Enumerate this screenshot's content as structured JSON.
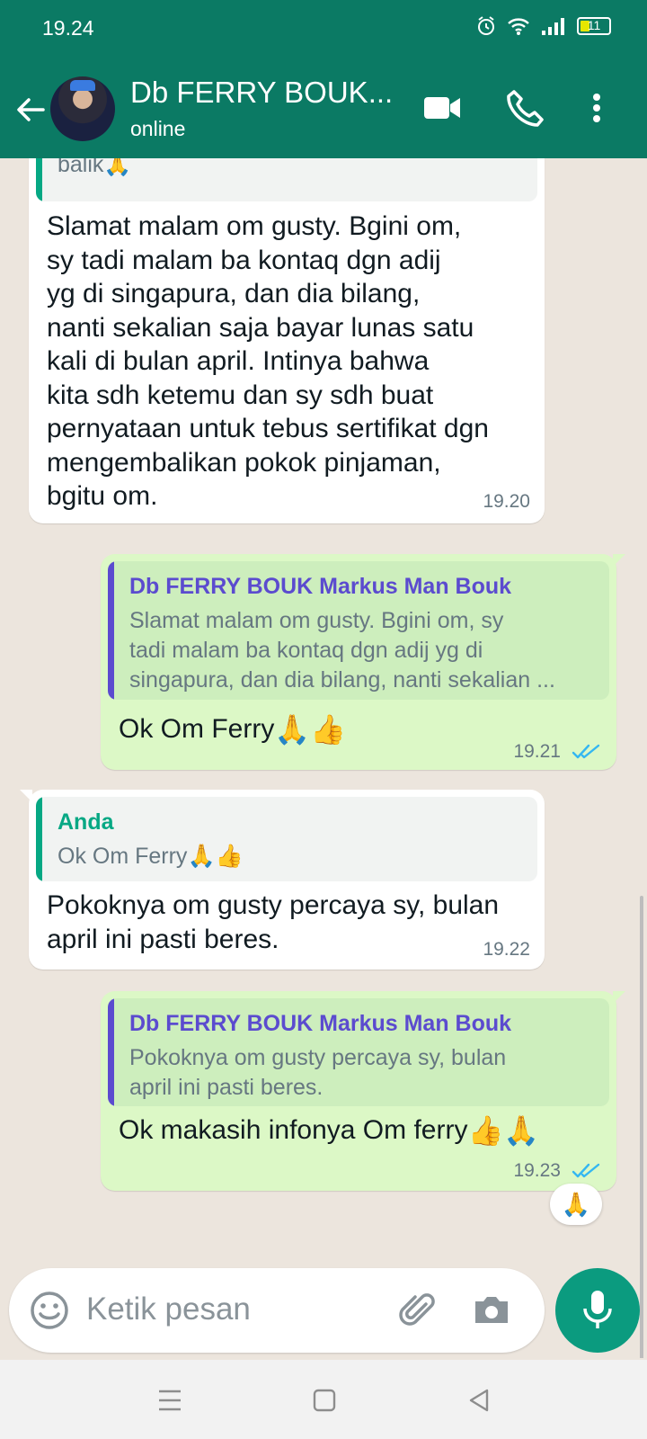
{
  "status_bar": {
    "time": "19.24",
    "battery": "11"
  },
  "header": {
    "name": "Db FERRY BOUK...",
    "status": "online"
  },
  "messages": [
    {
      "dir": "in",
      "quote_text": "Hari Jumat lusa kawan, mohon bantuan info balik🙏",
      "text_lines": [
        "Slamat malam om gusty. Bgini om,",
        "sy tadi malam ba kontaq dgn adij",
        "yg di singapura, dan dia bilang,",
        "nanti sekalian saja bayar lunas satu",
        "kali di bulan april. Intinya bahwa",
        "kita sdh ketemu dan sy sdh buat",
        "pernyataan untuk tebus sertifikat dgn",
        "mengembalikan pokok pinjaman,",
        "bgitu om."
      ],
      "time": "19.20"
    },
    {
      "dir": "out",
      "quote_name": "Db FERRY BOUK Markus Man Bouk",
      "quote_lines": [
        "Slamat malam om gusty. Bgini om, sy",
        "tadi malam ba kontaq dgn adij yg di",
        "singapura, dan dia bilang, nanti sekalian ..."
      ],
      "text": "Ok Om Ferry",
      "time": "19.21"
    },
    {
      "dir": "in",
      "quote_name": "Anda",
      "quote_text": "Ok Om Ferry",
      "text_lines": [
        "Pokoknya om gusty percaya sy, bulan",
        "april ini pasti beres."
      ],
      "time": "19.22"
    },
    {
      "dir": "out",
      "quote_name": "Db FERRY BOUK Markus Man Bouk",
      "quote_lines": [
        "Pokoknya om gusty percaya sy, bulan",
        "april ini pasti beres."
      ],
      "text": "Ok makasih infonya Om ferry",
      "time": "19.23"
    }
  ],
  "composer": {
    "placeholder": "Ketik pesan"
  },
  "colors": {
    "header_bg": "#0b7a64",
    "incoming_bubble": "#ffffff",
    "outgoing_bubble": "#dcf8c6",
    "quote_bar_contact": "#5b4bcf",
    "quote_bar_self": "#06a884",
    "read_ticks": "#34b7f1",
    "mic_button": "#0b9b7f"
  },
  "icons": {
    "back": "arrow-left-icon",
    "video": "video-call-icon",
    "call": "phone-icon",
    "more": "more-vert-icon",
    "emoji": "emoji-icon",
    "attach": "paperclip-icon",
    "camera": "camera-icon",
    "mic": "mic-icon"
  }
}
